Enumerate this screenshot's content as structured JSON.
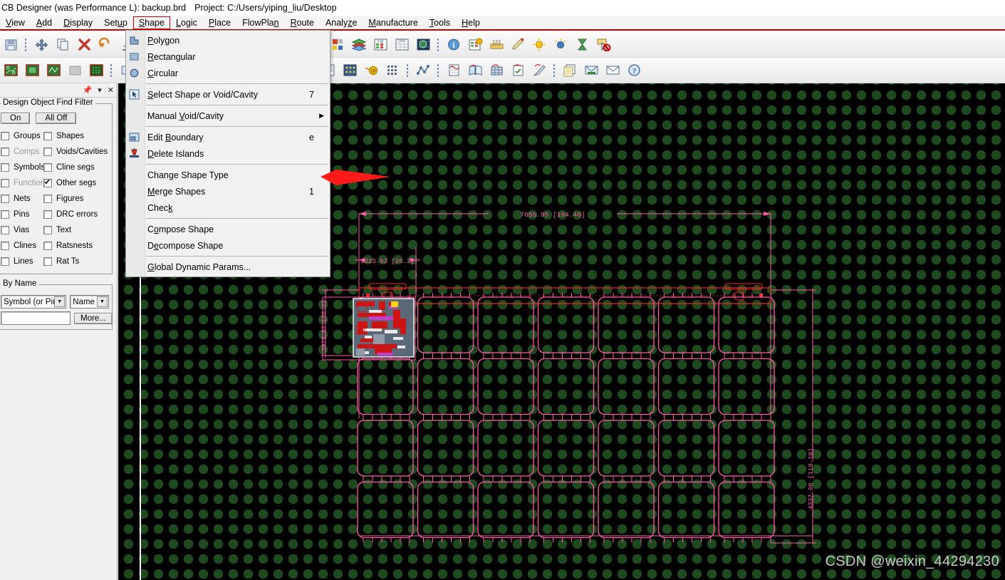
{
  "window": {
    "title_app": "CB Designer (was Performance L): backup.brd",
    "title_project": "Project: C:/Users/yiping_liu/Desktop"
  },
  "menubar": {
    "items": [
      {
        "label": "View",
        "mnemonic": "V",
        "active": false
      },
      {
        "label": "Add",
        "mnemonic": "A",
        "active": false
      },
      {
        "label": "Display",
        "mnemonic": "D",
        "active": false
      },
      {
        "label": "Setup",
        "mnemonic": "u",
        "active": false
      },
      {
        "label": "Shape",
        "mnemonic": "S",
        "active": true
      },
      {
        "label": "Logic",
        "mnemonic": "L",
        "active": false
      },
      {
        "label": "Place",
        "mnemonic": "P",
        "active": false
      },
      {
        "label": "FlowPlan",
        "mnemonic": "n",
        "active": false
      },
      {
        "label": "Route",
        "mnemonic": "R",
        "active": false
      },
      {
        "label": "Analyze",
        "mnemonic": "z",
        "active": false
      },
      {
        "label": "Manufacture",
        "mnemonic": "M",
        "active": false
      },
      {
        "label": "Tools",
        "mnemonic": "T",
        "active": false
      },
      {
        "label": "Help",
        "mnemonic": "H",
        "active": false
      }
    ]
  },
  "shape_menu": {
    "open": true,
    "items": [
      {
        "label": "Polygon",
        "mnemonic": "P",
        "accel": "",
        "icon": "polygon-shape-icon",
        "submenu": false
      },
      {
        "label": "Rectangular",
        "mnemonic": "R",
        "accel": "",
        "icon": "rectangle-shape-icon",
        "submenu": false
      },
      {
        "label": "Circular",
        "mnemonic": "C",
        "accel": "",
        "icon": "circle-shape-icon",
        "submenu": false
      },
      {
        "separator": true
      },
      {
        "label": "Select Shape or Void/Cavity",
        "mnemonic": "S",
        "accel": "7",
        "icon": "select-arrow-icon",
        "submenu": false
      },
      {
        "separator": true
      },
      {
        "label": "Manual Void/Cavity",
        "mnemonic": "V",
        "accel": "",
        "icon": "",
        "submenu": true
      },
      {
        "separator": true
      },
      {
        "label": "Edit Boundary",
        "mnemonic": "B",
        "accel": "e",
        "icon": "edit-boundary-icon",
        "submenu": false
      },
      {
        "label": "Delete Islands",
        "mnemonic": "D",
        "accel": "",
        "icon": "delete-islands-icon",
        "submenu": false
      },
      {
        "separator": true
      },
      {
        "label": "Change Shape Type",
        "mnemonic": "",
        "accel": "",
        "icon": "",
        "submenu": false
      },
      {
        "label": "Merge Shapes",
        "mnemonic": "M",
        "accel": "1",
        "icon": "",
        "submenu": false
      },
      {
        "label": "Check",
        "mnemonic": "k",
        "accel": "",
        "icon": "",
        "submenu": false
      },
      {
        "separator": true
      },
      {
        "label": "Compose Shape",
        "mnemonic": "o",
        "accel": "",
        "icon": "",
        "submenu": false
      },
      {
        "label": "Decompose Shape",
        "mnemonic": "e",
        "accel": "",
        "icon": "",
        "submenu": false
      },
      {
        "separator": true
      },
      {
        "label": "Global Dynamic Params...",
        "mnemonic": "G",
        "accel": "",
        "icon": "",
        "submenu": false
      }
    ]
  },
  "toolbar_row1": [
    {
      "icon": "save-icon",
      "group_start": false
    },
    {
      "icon": "move-icon",
      "group_start": true
    },
    {
      "icon": "copy-icon",
      "group_start": false
    },
    {
      "icon": "delete-x-icon",
      "group_start": false
    },
    {
      "icon": "undo-icon",
      "group_start": false
    },
    {
      "icon": "insert-down-icon",
      "group_start": false
    },
    {
      "icon": "zoom-fit-icon",
      "group_start": true
    },
    {
      "icon": "zoom-in-icon",
      "group_start": false
    },
    {
      "icon": "zoom-region-icon",
      "group_start": false
    },
    {
      "icon": "refresh-icon",
      "group_start": false
    },
    {
      "icon": "3d-view-icon",
      "group_start": false
    },
    {
      "icon": "flip-design-icon",
      "group_start": false
    },
    {
      "icon": "grid-toggle-icon",
      "group_start": true
    },
    {
      "icon": "color-palette-icon",
      "group_start": false
    },
    {
      "icon": "subclass-visibility-icon",
      "group_start": false
    },
    {
      "icon": "layers-icon",
      "group_start": false
    },
    {
      "icon": "constraint-manager-icon",
      "group_start": false
    },
    {
      "icon": "dfa-table-icon",
      "group_start": false
    },
    {
      "icon": "world-view-icon",
      "group_start": false
    },
    {
      "icon": "info-icon",
      "group_start": true
    },
    {
      "icon": "report-icon",
      "group_start": false
    },
    {
      "icon": "measure-icon",
      "group_start": false
    },
    {
      "icon": "highlight-icon",
      "group_start": false
    },
    {
      "icon": "brightness-up-icon",
      "group_start": false
    },
    {
      "icon": "shadow-icon",
      "group_start": false
    },
    {
      "icon": "hourglass-icon",
      "group_start": false
    },
    {
      "icon": "cancel-cursor-icon",
      "group_start": false
    }
  ],
  "toolbar_row2": [
    {
      "icon": "board-route-icon",
      "group_start": false
    },
    {
      "icon": "board-plane-icon",
      "group_start": false
    },
    {
      "icon": "board-signal-icon",
      "group_start": false
    },
    {
      "icon": "blank-board-icon",
      "group_start": false
    },
    {
      "icon": "board-array-icon",
      "group_start": false
    },
    {
      "icon": "padstack-icon",
      "group_start": true
    },
    {
      "icon": "panel-board-icon",
      "group_start": false
    },
    {
      "icon": "dimension-start-icon",
      "group_start": false
    },
    {
      "icon": "dimension-span-icon",
      "group_start": false
    },
    {
      "icon": "odb-export-icon",
      "group_start": true
    },
    {
      "icon": "drill-legend-icon",
      "group_start": false
    },
    {
      "icon": "nc-drill-icon",
      "group_start": false
    },
    {
      "icon": "photoplot-icon",
      "group_start": false
    },
    {
      "icon": "revision-icon",
      "group_start": false
    },
    {
      "icon": "silkscreen-icon",
      "group_start": false
    },
    {
      "icon": "testprep-icon",
      "group_start": false
    },
    {
      "icon": "testpoint-icon",
      "group_start": false
    },
    {
      "icon": "bga-array-icon",
      "group_start": false
    },
    {
      "icon": "signal-analysis-icon",
      "group_start": true
    },
    {
      "icon": "report-doc-icon",
      "group_start": true
    },
    {
      "icon": "library-icon",
      "group_start": false
    },
    {
      "icon": "batch-sim-icon",
      "group_start": false
    },
    {
      "icon": "checklist-icon",
      "group_start": false
    },
    {
      "icon": "probe-icon",
      "group_start": false
    },
    {
      "icon": "notes-icon",
      "group_start": true
    },
    {
      "icon": "email-icon",
      "group_start": false
    },
    {
      "icon": "message-icon",
      "group_start": false
    },
    {
      "icon": "help-question-icon",
      "group_start": false
    }
  ],
  "find_panel": {
    "header_buttons": [
      "pin-icon",
      "dropdown-icon",
      "close-icon"
    ],
    "group_title": "Design Object Find Filter",
    "all_on_label": "On",
    "all_off_label": "All Off",
    "left_column": [
      {
        "label": "Groups",
        "enabled": true
      },
      {
        "label": "Comps",
        "enabled": false
      },
      {
        "label": "Symbols",
        "enabled": true
      },
      {
        "label": "Functions",
        "enabled": false
      },
      {
        "label": "Nets",
        "enabled": true
      },
      {
        "label": "Pins",
        "enabled": true
      },
      {
        "label": "Vias",
        "enabled": true
      },
      {
        "label": "Clines",
        "enabled": true
      },
      {
        "label": "Lines",
        "enabled": true
      }
    ],
    "right_column": [
      {
        "label": "Shapes",
        "checked": false
      },
      {
        "label": "Voids/Cavities",
        "checked": false
      },
      {
        "label": "Cline segs",
        "checked": false
      },
      {
        "label": "Other segs",
        "checked": true
      },
      {
        "label": "Figures",
        "checked": false
      },
      {
        "label": "DRC errors",
        "checked": false
      },
      {
        "label": "Text",
        "checked": false
      },
      {
        "label": "Ratsnests",
        "checked": false
      },
      {
        "label": "Rat Ts",
        "checked": false
      }
    ],
    "by_name": {
      "group_title": "By Name",
      "object_type_value": "Symbol (or Pin)",
      "name_mode_value": "Name",
      "search_value": "",
      "more_label": "More..."
    }
  },
  "canvas": {
    "background": "#000000",
    "grid_dot_color": "#1f4a1f",
    "outline_color": "#ff5aa8",
    "board_color": "#ff2020",
    "dimensions": {
      "top_width": "7655.95 [194.46]",
      "left_offset": "1023.62 [26.2]",
      "right_height": "4337.08 [110.18]"
    },
    "panel_grid": {
      "rows": 4,
      "cols": 7
    },
    "watermark": "CSDN @weixin_44294230"
  },
  "annotation": {
    "arrow_color": "#ff1a1a",
    "points_to": "Merge Shapes"
  }
}
